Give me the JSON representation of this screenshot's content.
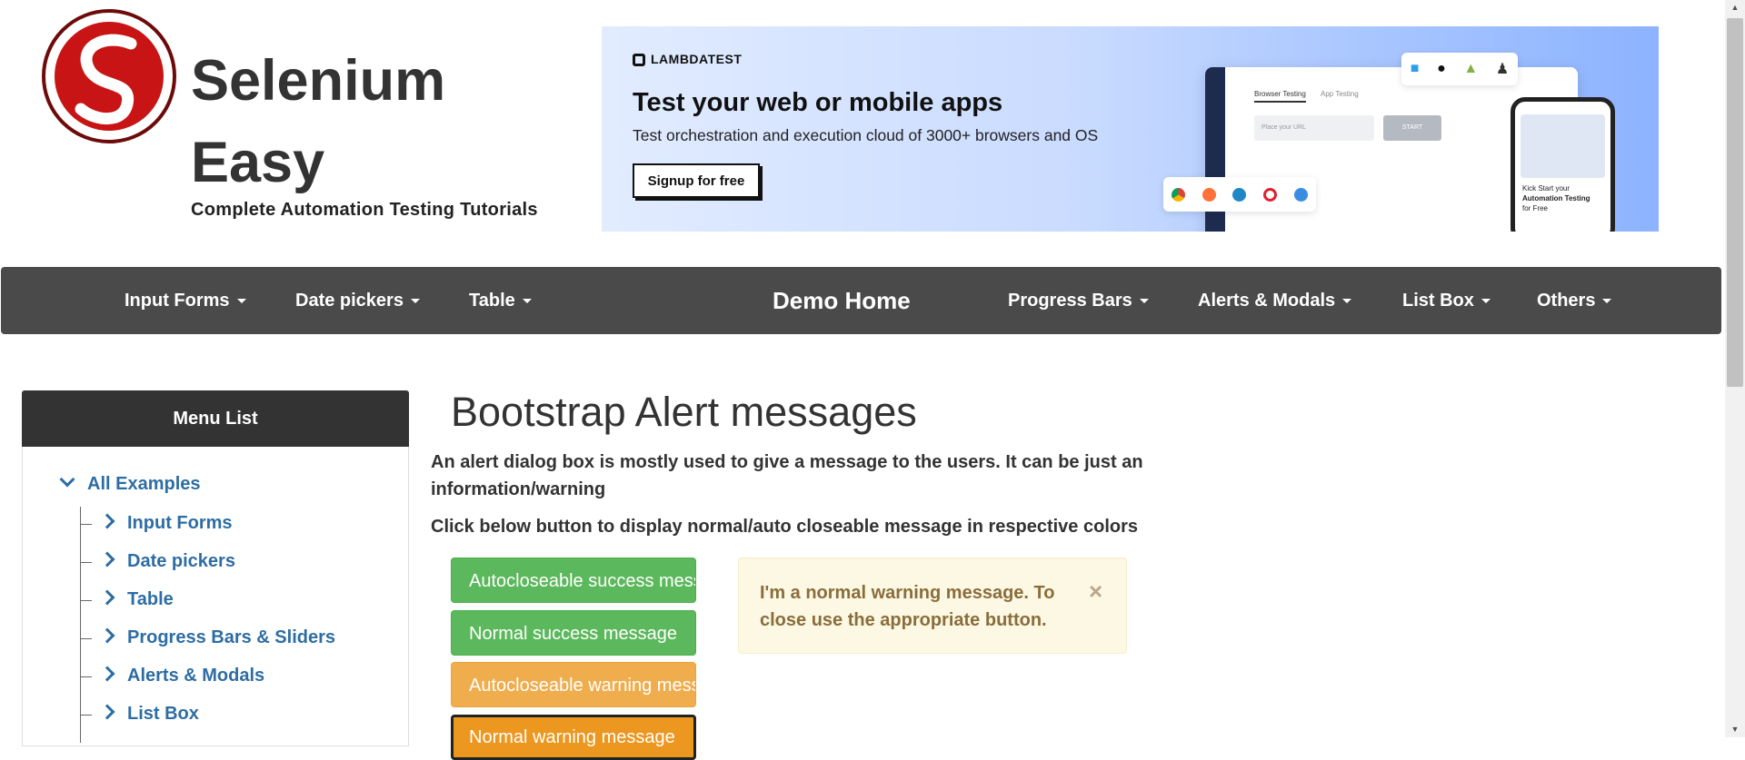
{
  "brand": {
    "title_line1": "Selenium",
    "title_line2": "Easy",
    "subtitle": "Complete Automation Testing Tutorials"
  },
  "banner": {
    "logo_text": "LAMBDATEST",
    "headline": "Test your web or mobile apps",
    "text": "Test orchestration and execution cloud of 3000+ browsers and OS",
    "button_label": "Signup for free",
    "mock_tab_1": "Browser Testing",
    "mock_tab_2": "App Testing",
    "mock_url_placeholder": "Place your URL",
    "mock_start": "START",
    "phone_text_1": "Kick Start your",
    "phone_text_2": "Automation Testing",
    "phone_text_3": "for Free",
    "colors": {
      "bg_start": "#e2ecff",
      "bg_end": "#8db3ff"
    }
  },
  "navbar": {
    "items_left": [
      "Input Forms",
      "Date pickers",
      "Table"
    ],
    "home": "Demo Home",
    "items_right": [
      "Progress Bars",
      "Alerts & Modals",
      "List Box",
      "Others"
    ]
  },
  "sidebar": {
    "header": "Menu List",
    "root": "All Examples",
    "items": [
      "Input Forms",
      "Date pickers",
      "Table",
      "Progress Bars & Sliders",
      "Alerts & Modals",
      "List Box"
    ]
  },
  "main": {
    "title": "Bootstrap Alert messages",
    "description": "An alert dialog box is mostly used to give a message to the users. It can be just an information/warning",
    "instruction": "Click below button to display normal/auto closeable message in respective colors",
    "buttons": [
      "Autocloseable success message",
      "Normal success message",
      "Autocloseable warning message",
      "Normal warning message"
    ],
    "alert": {
      "text": "I'm a normal warning message. To close use the appropriate button.",
      "close": "×"
    }
  },
  "icons": {
    "logo": "selenium-easy-logo",
    "scroll_up": "scroll-up-arrow-icon",
    "scroll_down": "scroll-down-arrow-icon"
  },
  "colors": {
    "navbar": "#4a4a4a",
    "link": "#2d6da3",
    "success": "#5cb85c",
    "warning": "#f0ad4e",
    "alert_bg": "#fcf8e3",
    "alert_text": "#8a6d3b"
  }
}
